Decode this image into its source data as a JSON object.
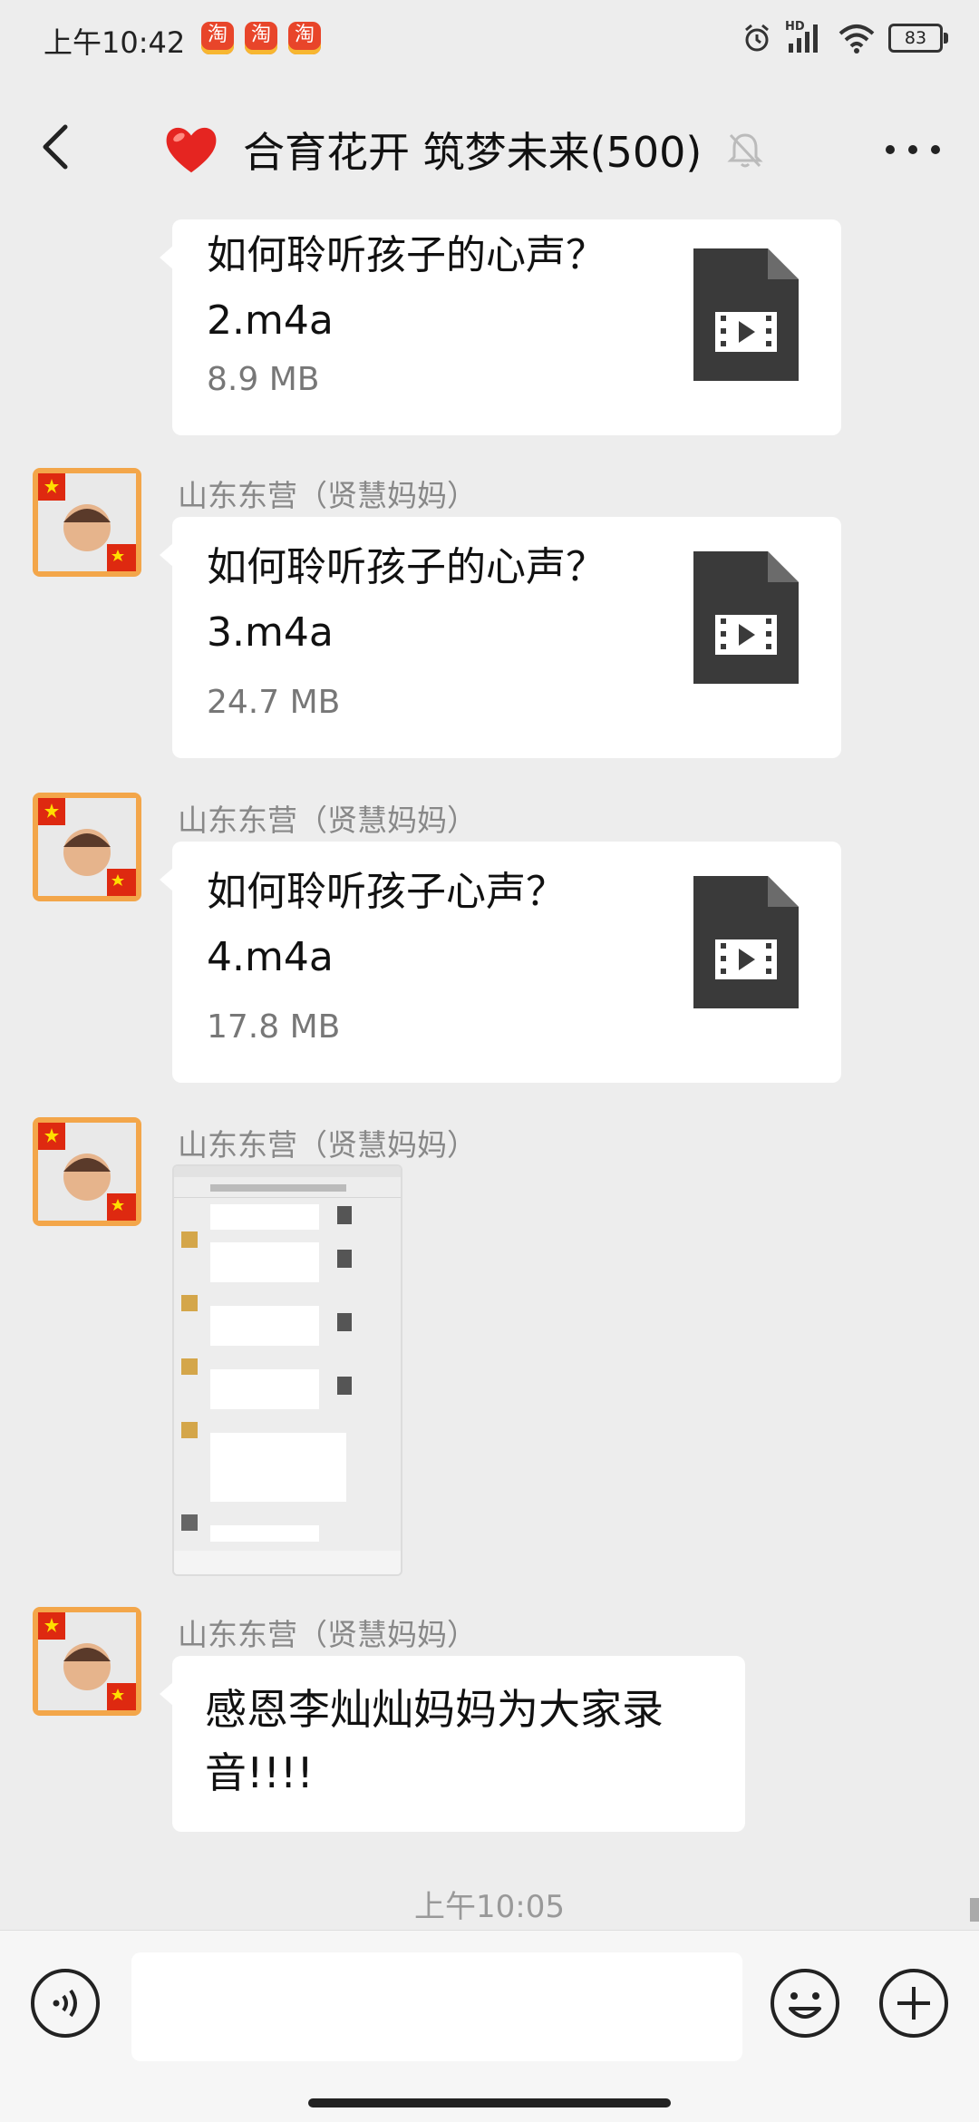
{
  "status_bar": {
    "time": "上午10:42",
    "app_icon_text": "淘",
    "battery": "83",
    "hd_label": "HD"
  },
  "header": {
    "title": "合育花开 筑梦未来(500)"
  },
  "messages": [
    {
      "file_title": "如何聆听孩子的心声？2.m4a",
      "file_size": "8.9 MB"
    },
    {
      "sender": "山东东营（贤慧妈妈）",
      "file_title": "如何聆听孩子的心声？3.m4a",
      "file_size": "24.7 MB"
    },
    {
      "sender": "山东东营（贤慧妈妈）",
      "file_title": "如何聆听孩子心声？4.m4a",
      "file_size": "17.8 MB"
    },
    {
      "sender": "山东东营（贤慧妈妈）"
    },
    {
      "sender": "山东东营（贤慧妈妈）",
      "text": "感恩李灿灿妈妈为大家录音!!!!"
    }
  ],
  "timestamp": "上午10:05",
  "input": {
    "placeholder": ""
  },
  "colors": {
    "background": "#ededed",
    "bubble": "#ffffff",
    "file_icon": "#3a3a3a",
    "heart": "#e52521",
    "avatar_flag": "#de2910"
  }
}
